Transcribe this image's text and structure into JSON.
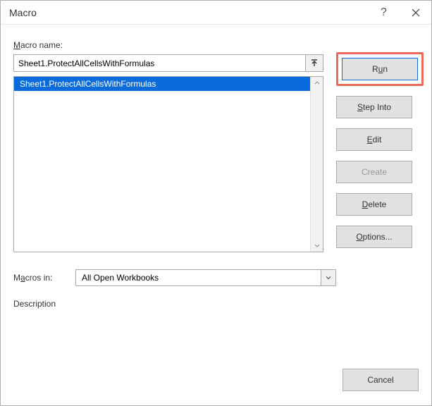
{
  "window": {
    "title": "Macro"
  },
  "labels": {
    "macro_name": "acro name:",
    "macro_name_prefix": "M",
    "macros_in": "M",
    "macros_in_rest": "acros in:",
    "description": "Description"
  },
  "name_input": {
    "value": "Sheet1.ProtectAllCellsWithFormulas"
  },
  "list": {
    "items": [
      {
        "label": "Sheet1.ProtectAllCellsWithFormulas",
        "selected": true
      }
    ]
  },
  "scope_select": {
    "value": "All Open Workbooks"
  },
  "buttons": {
    "run_prefix": "R",
    "run_mid": "u",
    "run_suffix": "n",
    "stepinto_prefix": "S",
    "stepinto_rest": "tep Into",
    "edit_prefix": "E",
    "edit_rest": "dit",
    "create": "Create",
    "delete_prefix": "D",
    "delete_rest": "elete",
    "options_prefix": "O",
    "options_rest": "ptions...",
    "cancel": "Cancel"
  }
}
